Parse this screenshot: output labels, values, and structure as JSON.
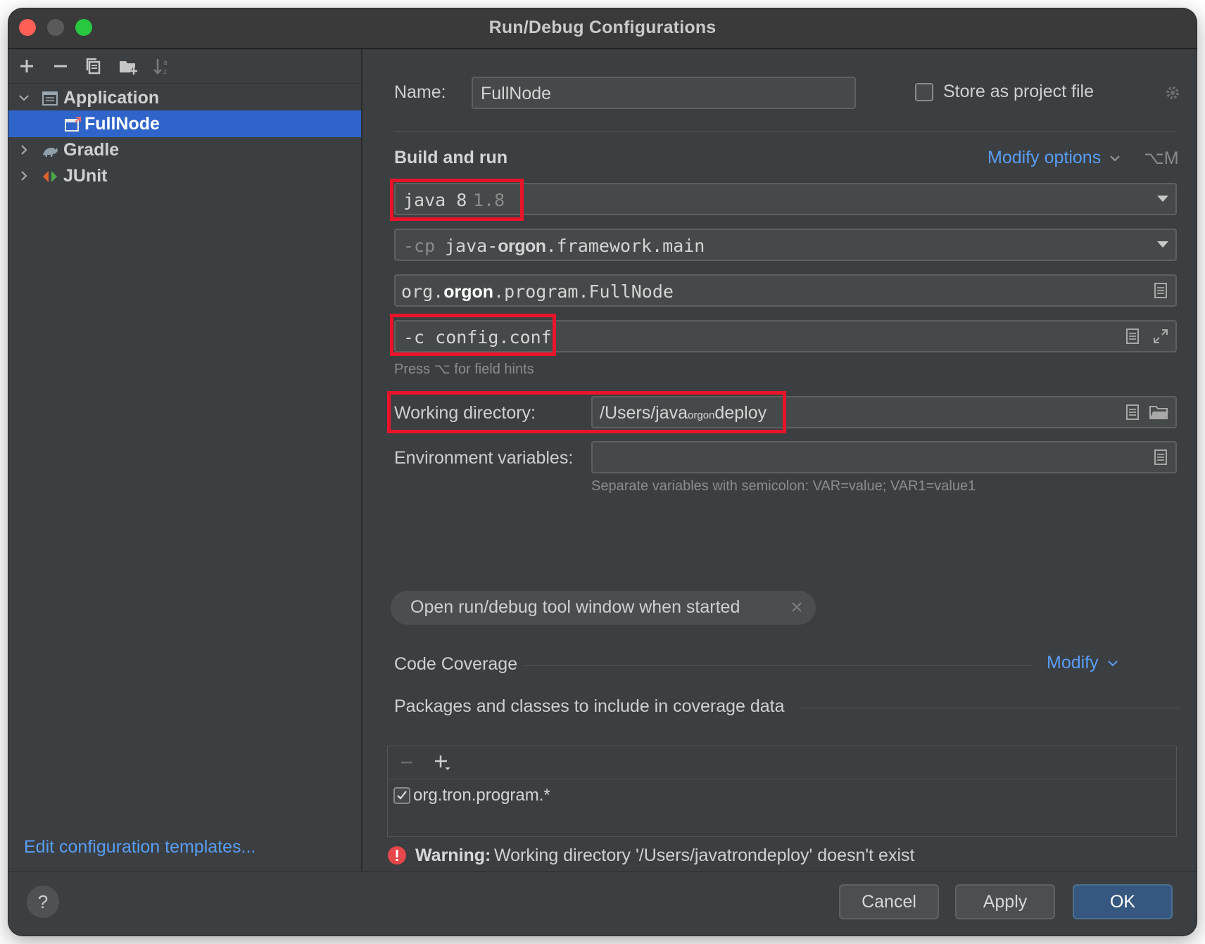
{
  "window": {
    "title": "Run/Debug Configurations"
  },
  "tree": {
    "items": [
      {
        "label": "Application",
        "expanded": true
      },
      {
        "label": "FullNode",
        "selected": true
      },
      {
        "label": "Gradle",
        "expanded": false
      },
      {
        "label": "JUnit",
        "expanded": false
      }
    ],
    "edit_templates": "Edit configuration templates..."
  },
  "name": {
    "label": "Name:",
    "value": "FullNode"
  },
  "store": {
    "label": "Store as project file",
    "checked": false
  },
  "build": {
    "title": "Build and run",
    "modify_options": "Modify options",
    "shortcut": "⌥M",
    "jre": {
      "main": "java 8",
      "version": "1.8"
    },
    "classpath": {
      "flag": "-cp",
      "value_pre": "java-",
      "value_bold": "orgon",
      "value_post": ".framework.main"
    },
    "main_class": {
      "pre": "org.",
      "bold": "orgon",
      "post": ".program.FullNode"
    },
    "program_args": "-c config.conf",
    "field_hint": "Press ⌥ for field hints"
  },
  "workdir": {
    "label": "Working directory:",
    "value_pre": "/Users/java",
    "value_small": "orgon",
    "value_post": "deploy"
  },
  "env": {
    "label": "Environment variables:",
    "value": "",
    "hint": "Separate variables with semicolon: VAR=value; VAR1=value1"
  },
  "chip": {
    "label": "Open run/debug tool window when started"
  },
  "coverage": {
    "title": "Code Coverage",
    "modify": "Modify",
    "packages_title": "Packages and classes to include in coverage data",
    "packages": [
      {
        "pattern": "org.tron.program.*",
        "checked": true
      }
    ]
  },
  "warning": {
    "prefix": "Warning:",
    "text": "Working directory '/Users/javatrondeploy' doesn't exist"
  },
  "buttons": {
    "cancel": "Cancel",
    "apply": "Apply",
    "ok": "OK",
    "help": "?"
  },
  "colors": {
    "accent": "#2f65ca",
    "link": "#589df6",
    "highlight_box": "#e8142a",
    "warning": "#e5474a",
    "background": "#3c3f41"
  }
}
